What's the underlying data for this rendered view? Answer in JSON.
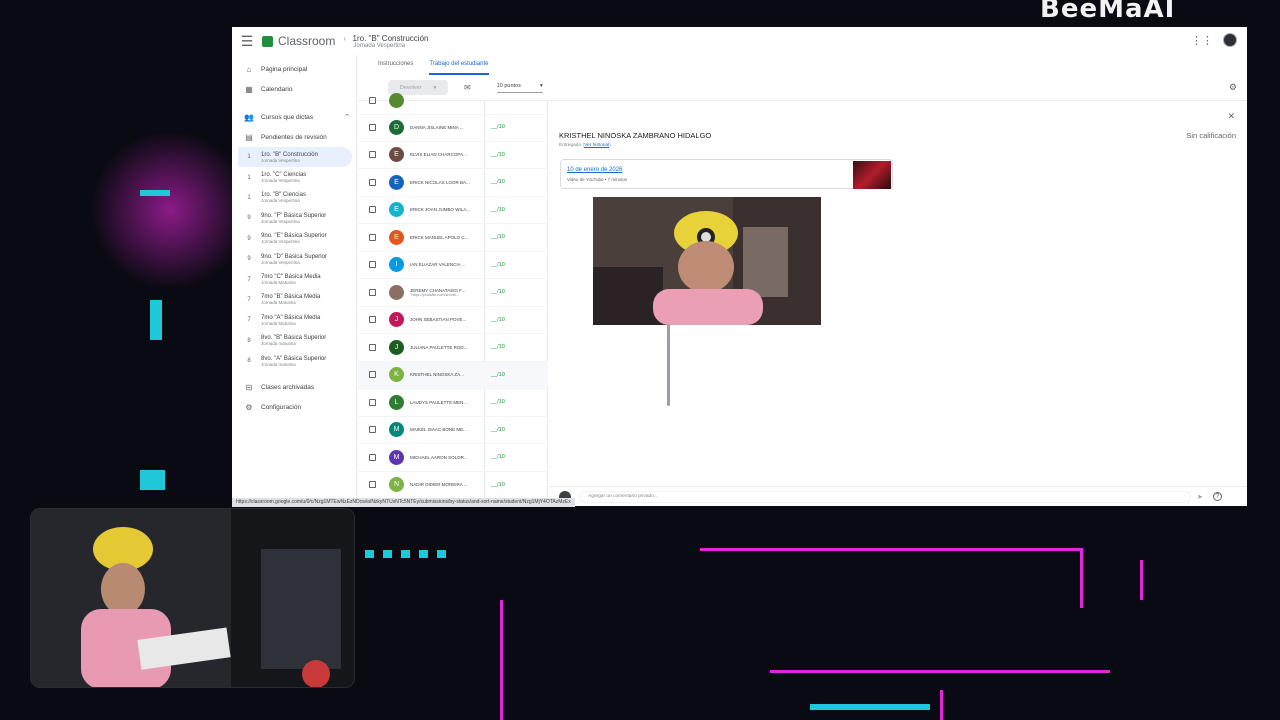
{
  "overlay": {
    "brand_text": "BeeMaAI"
  },
  "app": {
    "title": "Classroom",
    "breadcrumb_course": "1ro. \"B\" Construcción",
    "breadcrumb_sub": "Jornada Vespertina"
  },
  "sidebar": {
    "home": "Página principal",
    "calendar": "Calendario",
    "teaching": "Cursos que dictas",
    "review": "Pendientes de revisión",
    "courses": [
      {
        "badge": "1",
        "name": "1ro. \"B\" Construcción",
        "sub": "Jornada Vespertina"
      },
      {
        "badge": "1",
        "name": "1ro. \"C\" Ciencias",
        "sub": "Jornada Vespertina"
      },
      {
        "badge": "1",
        "name": "1ro. \"B\" Ciencias",
        "sub": "Jornada Vespertina"
      },
      {
        "badge": "9",
        "name": "9no. \"F\" Básica Superior",
        "sub": "Jornada Vespertina"
      },
      {
        "badge": "9",
        "name": "9no. \"E\" Básica Superior",
        "sub": "Jornada Vespertina"
      },
      {
        "badge": "9",
        "name": "9no. \"D\" Básica Superior",
        "sub": "Jornada Vespertina"
      },
      {
        "badge": "7",
        "name": "7mo \"C\" Básica Media",
        "sub": "Jornada Matutina"
      },
      {
        "badge": "7",
        "name": "7mo \"B\" Básica Media",
        "sub": "Jornada Matutina"
      },
      {
        "badge": "7",
        "name": "7mo \"A\" Básica Media",
        "sub": "Jornada Matutina"
      },
      {
        "badge": "8",
        "name": "8vo. \"B\" Básica Superior",
        "sub": "Jornada matutina"
      },
      {
        "badge": "8",
        "name": "8vo. \"A\" Básica Superior",
        "sub": "Jornada matutina"
      }
    ],
    "archived": "Clases archivadas",
    "settings": "Configuración"
  },
  "tabs": {
    "instructions": "Instrucciones",
    "student_work": "Trabajo del estudiante"
  },
  "toolbar": {
    "return_label": "Devolver",
    "points": "10 puntos"
  },
  "students": [
    {
      "initial": "D",
      "color": "#1e6b3a",
      "name": "DANNA JISLAINE MINA ...",
      "sub": "",
      "grade": "__/10"
    },
    {
      "initial": "E",
      "color": "#6d4c41",
      "name": "ELVIS ELIAN CHARCOPA...",
      "sub": "",
      "grade": "__/10"
    },
    {
      "initial": "E",
      "color": "#1565c0",
      "name": "ERICK NICOLAS LOOR BA...",
      "sub": "",
      "grade": "__/10"
    },
    {
      "initial": "E",
      "color": "#12b5cb",
      "name": "ERICK JOAN JUMBO WILA...",
      "sub": "",
      "grade": "__/10"
    },
    {
      "initial": "E",
      "color": "#e8541e",
      "name": "ERICK MANUEL APOLO C...",
      "sub": "",
      "grade": "__/10"
    },
    {
      "initial": "I",
      "color": "#039be5",
      "name": "IAN ELIAZAR VALENCIA ...",
      "sub": "",
      "grade": "__/10"
    },
    {
      "initial": "",
      "color": "#8d6e63",
      "name": "JEREMY CHANATASIG F...",
      "sub": "\"https://youtube.com/shorts...",
      "grade": "__/10"
    },
    {
      "initial": "J",
      "color": "#c2185b",
      "name": "JOHN SEBASTIAN POVE...",
      "sub": "",
      "grade": "__/10"
    },
    {
      "initial": "J",
      "color": "#1b5e20",
      "name": "JULIANA PAULETTE ROD...",
      "sub": "",
      "grade": "__/10"
    },
    {
      "initial": "K",
      "color": "#7cb342",
      "name": "KRISTHEL NINOSKA ZA...",
      "sub": "",
      "grade": "__/10"
    },
    {
      "initial": "L",
      "color": "#2e7d32",
      "name": "LAUDYS PAULETTE MEN...",
      "sub": "",
      "grade": "__/10"
    },
    {
      "initial": "M",
      "color": "#00897b",
      "name": "MAIKEL ISAAC BONE ME...",
      "sub": "",
      "grade": "__/10"
    },
    {
      "initial": "M",
      "color": "#5e35b1",
      "name": "MICHAEL AARON SOLOR...",
      "sub": "",
      "grade": "__/10"
    },
    {
      "initial": "N",
      "color": "#7cb342",
      "name": "NADIR DIDIER MOREIRA ...",
      "sub": "",
      "grade": "__/10"
    }
  ],
  "detail": {
    "student_name": "KRISTHEL NINOSKA ZAMBRANO HIDALGO",
    "status": "Entregado",
    "history_link": "Ver historial",
    "grade_status": "Sin calificación",
    "attachment_title": "10 de enero de 2026",
    "attachment_meta": "Video de YouTube • 7 minutos",
    "comment_placeholder": "Agregar un comentario privado..."
  },
  "status_url": "https://classroom.google.com/u/0/c/Nzg1MTEwNzEzNDcw/a/NzkyNTUxNTc5NTEy/submissions/by-status/and-sort-name/student/Nzg1MjY4OTAzMzEx"
}
